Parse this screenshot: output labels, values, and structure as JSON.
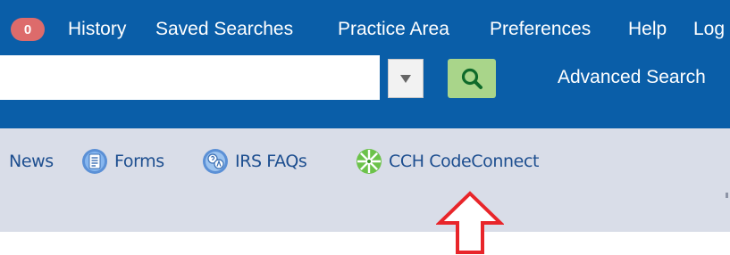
{
  "topnav": {
    "badge_count": "0",
    "links": [
      "History",
      "Saved Searches",
      "Practice Area",
      "Preferences",
      "Help",
      "Log"
    ]
  },
  "search": {
    "value": "",
    "dropdown_icon": "chevron-down-icon",
    "search_icon": "search-icon",
    "advanced_label": "Advanced Search"
  },
  "toolbar": {
    "items": [
      {
        "label": "News",
        "icon": null
      },
      {
        "label": "Forms",
        "icon": "forms-icon"
      },
      {
        "label": "IRS FAQs",
        "icon": "irs-faqs-icon"
      },
      {
        "label": "CCH CodeConnect",
        "icon": "codeconnect-icon"
      }
    ]
  },
  "annotation": {
    "icon": "up-arrow-icon",
    "color": "#e8252a"
  },
  "colors": {
    "nav_bg": "#0a5ea8",
    "toolbar_bg": "#d9dde8",
    "badge": "#dd6b6b",
    "search_button": "#a9d58a",
    "toolbar_text": "#1d4e8f"
  }
}
